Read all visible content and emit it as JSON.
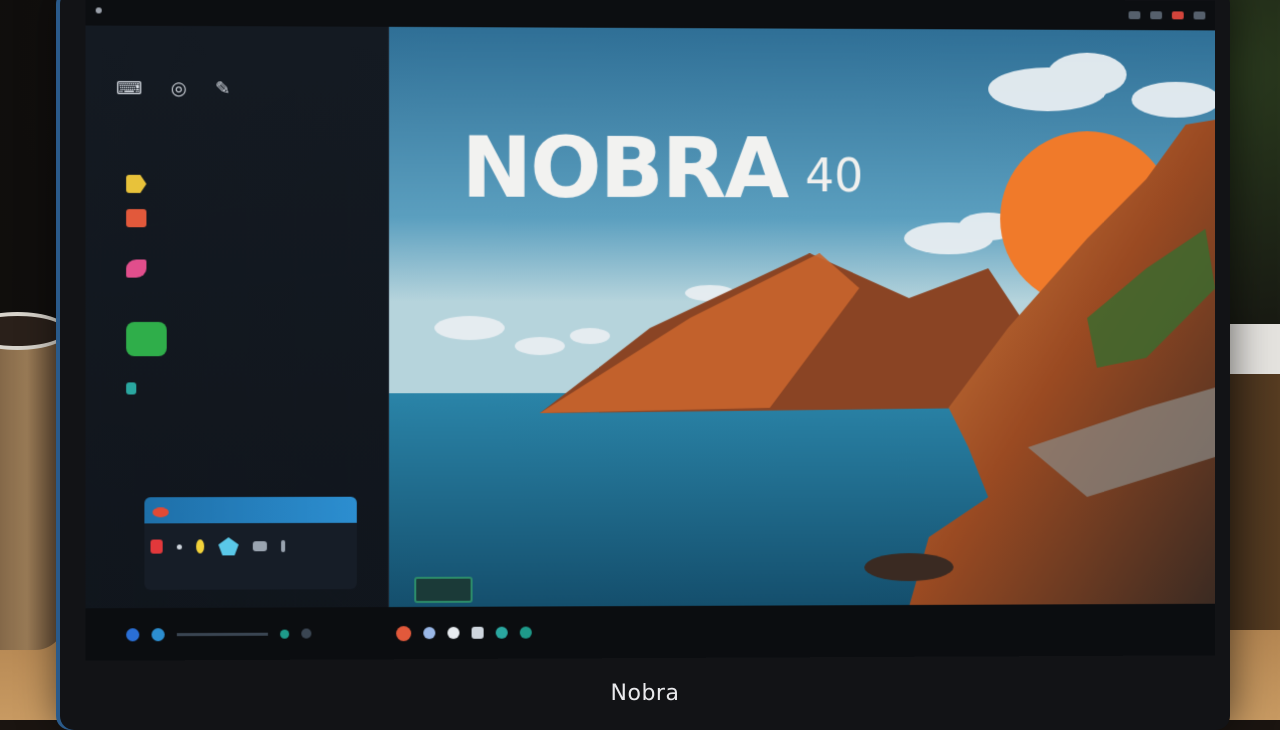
{
  "desktop": {
    "wallpaper_title": "NOBRA",
    "wallpaper_version": "40"
  },
  "laptop": {
    "brand": "Nobra"
  },
  "colors": {
    "sky_top": "#2f6f96",
    "sun": "#f07a2a",
    "sea": "#1e6a8e",
    "rock": "#c76a30",
    "accent": "#2c8ed0"
  },
  "sidebar": {
    "items": [
      {
        "icon": "folder-icon",
        "color": "#e8c23a"
      },
      {
        "icon": "app-red-icon",
        "color": "#e2593b"
      },
      {
        "icon": "app-pink-icon",
        "color": "#e14e8c"
      },
      {
        "icon": "chat-icon",
        "color": "#2fae4a"
      },
      {
        "icon": "app-teal-icon",
        "color": "#2aa7a0"
      }
    ]
  },
  "taskbar": {
    "dots": [
      "#2a6fd6",
      "#2c8ed0",
      "#1e9a8a",
      "#e2593b",
      "#9ab8e8",
      "#e8ecf0",
      "#cfd6de",
      "#2aa7a0",
      "#1e9a8a"
    ]
  }
}
